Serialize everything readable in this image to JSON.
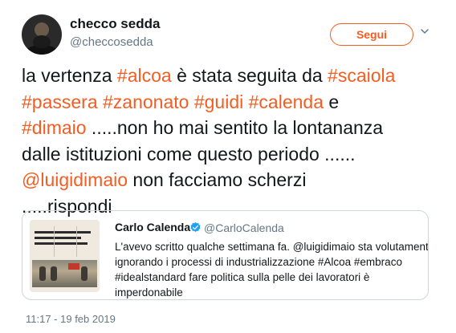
{
  "author": {
    "name": "checco sedda",
    "handle": "@checcosedda",
    "follow_label": "Segui"
  },
  "tweet_lines": [
    [
      {
        "text": "la vertenza "
      },
      {
        "text": "#alcoa",
        "tag": true
      },
      {
        "text": " è stata seguita da "
      },
      {
        "text": "#scaiola",
        "tag": true
      }
    ],
    [
      {
        "text": "#passera",
        "tag": true
      },
      {
        "text": " "
      },
      {
        "text": "#zanonato",
        "tag": true
      },
      {
        "text": " "
      },
      {
        "text": "#guidi",
        "tag": true
      },
      {
        "text": " "
      },
      {
        "text": "#calenda",
        "tag": true
      },
      {
        "text": " e"
      }
    ],
    [
      {
        "text": "#dimaio",
        "tag": true
      },
      {
        "text": " .....non ho mai sentito la lontananza"
      }
    ],
    [
      {
        "text": "dalle istituzioni come questo periodo ......"
      }
    ],
    [
      {
        "text": "@luigidimaio",
        "tag": true
      },
      {
        "text": " non facciamo scherzi"
      }
    ],
    [
      {
        "text": ".....rispondi"
      }
    ]
  ],
  "quoted": {
    "name": "Carlo Calenda",
    "handle": "@CarloCalenda",
    "lines": [
      "L'avevo scritto qualche settimana fa. @luigidimaio sta volutamente",
      "ignorando i processi di industrializzazione #Alcoa #embraco",
      "#idealstandard fare politica sulla pelle dei lavoratori è",
      "imperdonabile"
    ]
  },
  "timestamp": "11:17 - 19 feb 2019",
  "colors": {
    "accent": "#f45d22",
    "verified": "#1da1f2",
    "secondary_text": "#657786",
    "border": "#ccd6dd"
  },
  "icons": {
    "more": "chevron-down-icon",
    "verified": "verified-badge-icon"
  }
}
